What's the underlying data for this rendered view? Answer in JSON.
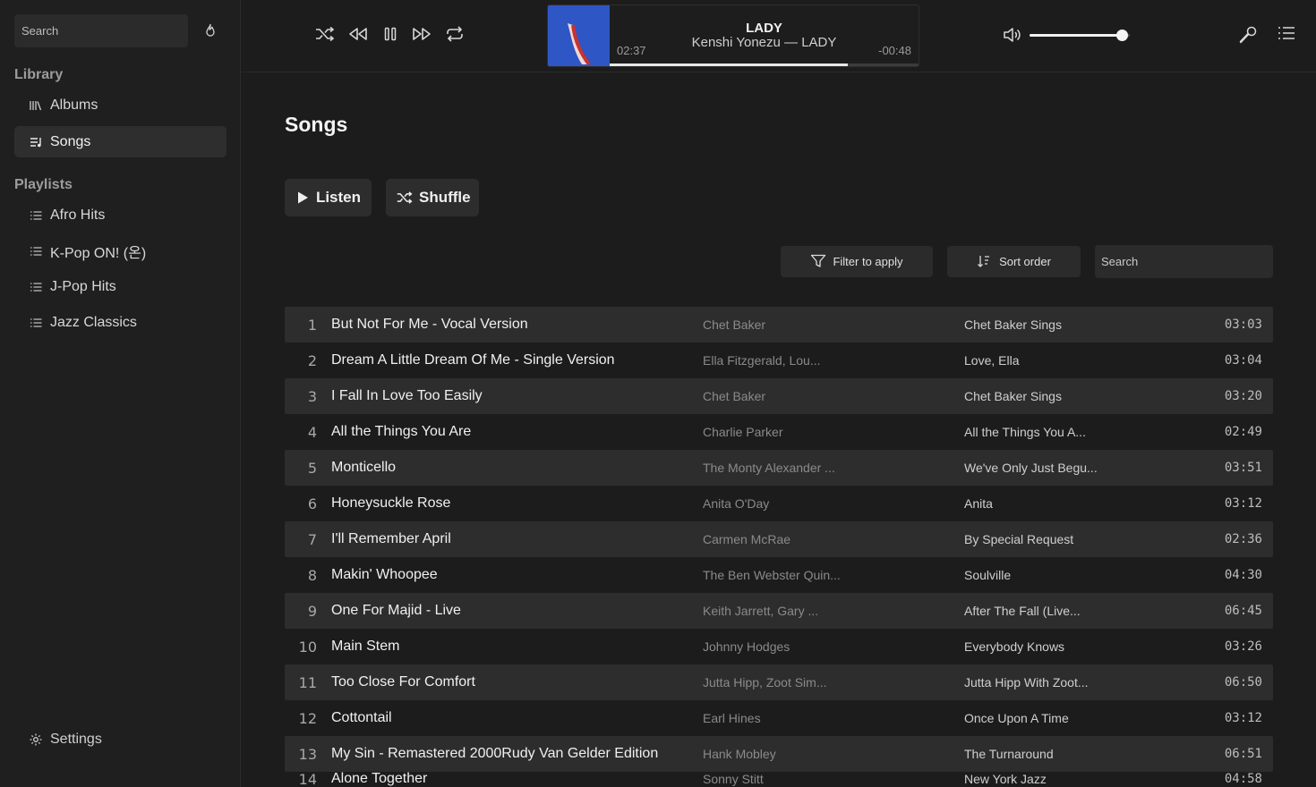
{
  "sidebar": {
    "search_placeholder": "Search",
    "library_title": "Library",
    "library_items": [
      {
        "label": "Albums",
        "icon": "library-icon"
      },
      {
        "label": "Songs",
        "icon": "songs-icon",
        "active": true
      }
    ],
    "playlists_title": "Playlists",
    "playlists": [
      {
        "label": "Afro Hits"
      },
      {
        "label": "K-Pop ON! (온)"
      },
      {
        "label": "J-Pop Hits"
      },
      {
        "label": "Jazz Classics"
      }
    ],
    "settings_label": "Settings"
  },
  "player": {
    "title": "LADY",
    "artist_album": "Kenshi Yonezu — LADY",
    "elapsed": "02:37",
    "remaining": "-00:48",
    "progress": 0.77,
    "volume": 0.92
  },
  "main": {
    "page_title": "Songs",
    "listen_label": "Listen",
    "shuffle_label": "Shuffle",
    "filter_label": "Filter to apply",
    "sort_label": "Sort order",
    "search_placeholder": "Search"
  },
  "songs": [
    {
      "n": "1",
      "title": "But Not For Me - Vocal Version",
      "artist": "Chet Baker",
      "album": "Chet Baker Sings",
      "duration": "03:03"
    },
    {
      "n": "2",
      "title": "Dream A Little Dream Of Me - Single Version",
      "artist": "Ella Fitzgerald, Lou...",
      "album": "Love, Ella",
      "duration": "03:04"
    },
    {
      "n": "3",
      "title": "I Fall In Love Too Easily",
      "artist": "Chet Baker",
      "album": "Chet Baker Sings",
      "duration": "03:20"
    },
    {
      "n": "4",
      "title": "All the Things You Are",
      "artist": "Charlie Parker",
      "album": "All the Things You A...",
      "duration": "02:49"
    },
    {
      "n": "5",
      "title": "Monticello",
      "artist": "The Monty Alexander ...",
      "album": "We've Only Just Begu...",
      "duration": "03:51"
    },
    {
      "n": "6",
      "title": "Honeysuckle Rose",
      "artist": "Anita O'Day",
      "album": "Anita",
      "duration": "03:12"
    },
    {
      "n": "7",
      "title": "I'll Remember April",
      "artist": "Carmen McRae",
      "album": "By Special Request",
      "duration": "02:36"
    },
    {
      "n": "8",
      "title": "Makin' Whoopee",
      "artist": "The Ben Webster Quin...",
      "album": "Soulville",
      "duration": "04:30"
    },
    {
      "n": "9",
      "title": "One For Majid - Live",
      "artist": "Keith Jarrett, Gary ...",
      "album": "After The Fall (Live...",
      "duration": "06:45"
    },
    {
      "n": "10",
      "title": "Main Stem",
      "artist": "Johnny Hodges",
      "album": "Everybody Knows",
      "duration": "03:26"
    },
    {
      "n": "11",
      "title": "Too Close For Comfort",
      "artist": "Jutta Hipp, Zoot Sim...",
      "album": "Jutta Hipp With Zoot...",
      "duration": "06:50"
    },
    {
      "n": "12",
      "title": "Cottontail",
      "artist": "Earl Hines",
      "album": "Once Upon A Time",
      "duration": "03:12"
    },
    {
      "n": "13",
      "title": "My Sin - Remastered 2000Rudy Van Gelder Edition",
      "artist": "Hank Mobley",
      "album": "The Turnaround",
      "duration": "06:51"
    },
    {
      "n": "14",
      "title": "Alone Together",
      "artist": "Sonny Stitt",
      "album": "New York Jazz",
      "duration": "04:58"
    }
  ]
}
